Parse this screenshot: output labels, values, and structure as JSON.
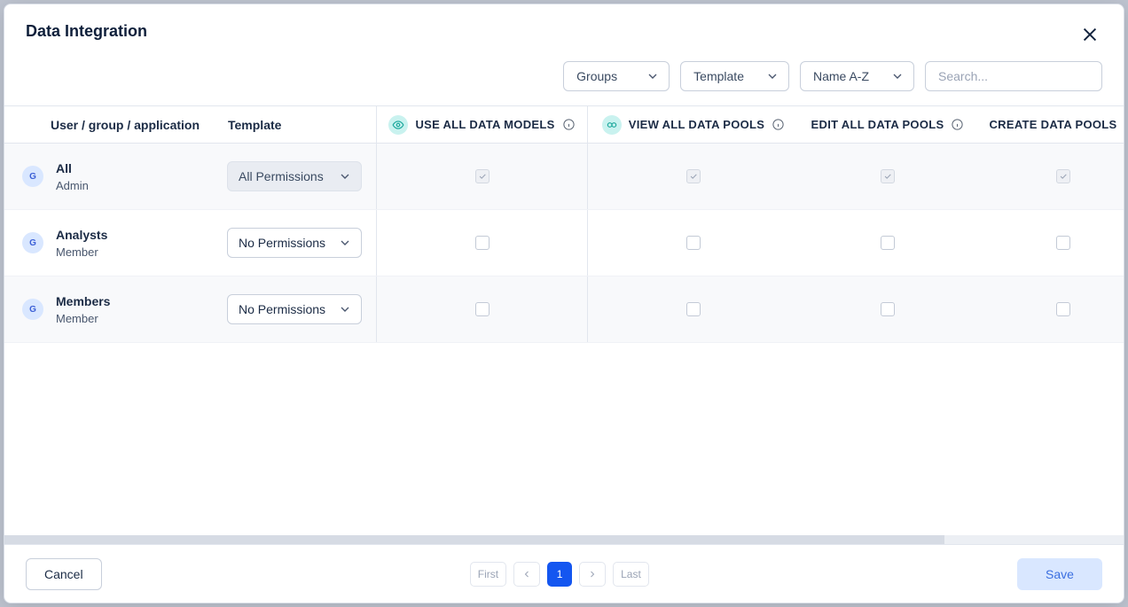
{
  "modal": {
    "title": "Data Integration"
  },
  "toolbar": {
    "filter_type": "Groups",
    "template": "Template",
    "sort": "Name A-Z",
    "search_placeholder": "Search..."
  },
  "headers": {
    "user": "User / group / application",
    "template": "Template",
    "perm_a": "USE ALL DATA MODELS",
    "perm_b": "VIEW ALL DATA POOLS",
    "perm_c": "EDIT ALL DATA POOLS",
    "perm_d": "CREATE DATA POOLS"
  },
  "rows": [
    {
      "avatar": "G",
      "name": "All",
      "role": "Admin",
      "template": "All Permissions",
      "template_disabled": true,
      "perms": {
        "a": true,
        "b": true,
        "c": true,
        "d": true
      },
      "perms_disabled": true
    },
    {
      "avatar": "G",
      "name": "Analysts",
      "role": "Member",
      "template": "No Permissions",
      "template_disabled": false,
      "perms": {
        "a": false,
        "b": false,
        "c": false,
        "d": false
      },
      "perms_disabled": false
    },
    {
      "avatar": "G",
      "name": "Members",
      "role": "Member",
      "template": "No Permissions",
      "template_disabled": false,
      "perms": {
        "a": false,
        "b": false,
        "c": false,
        "d": false
      },
      "perms_disabled": false
    }
  ],
  "pager": {
    "first": "First",
    "last": "Last",
    "current": "1"
  },
  "footer": {
    "cancel": "Cancel",
    "save": "Save"
  }
}
